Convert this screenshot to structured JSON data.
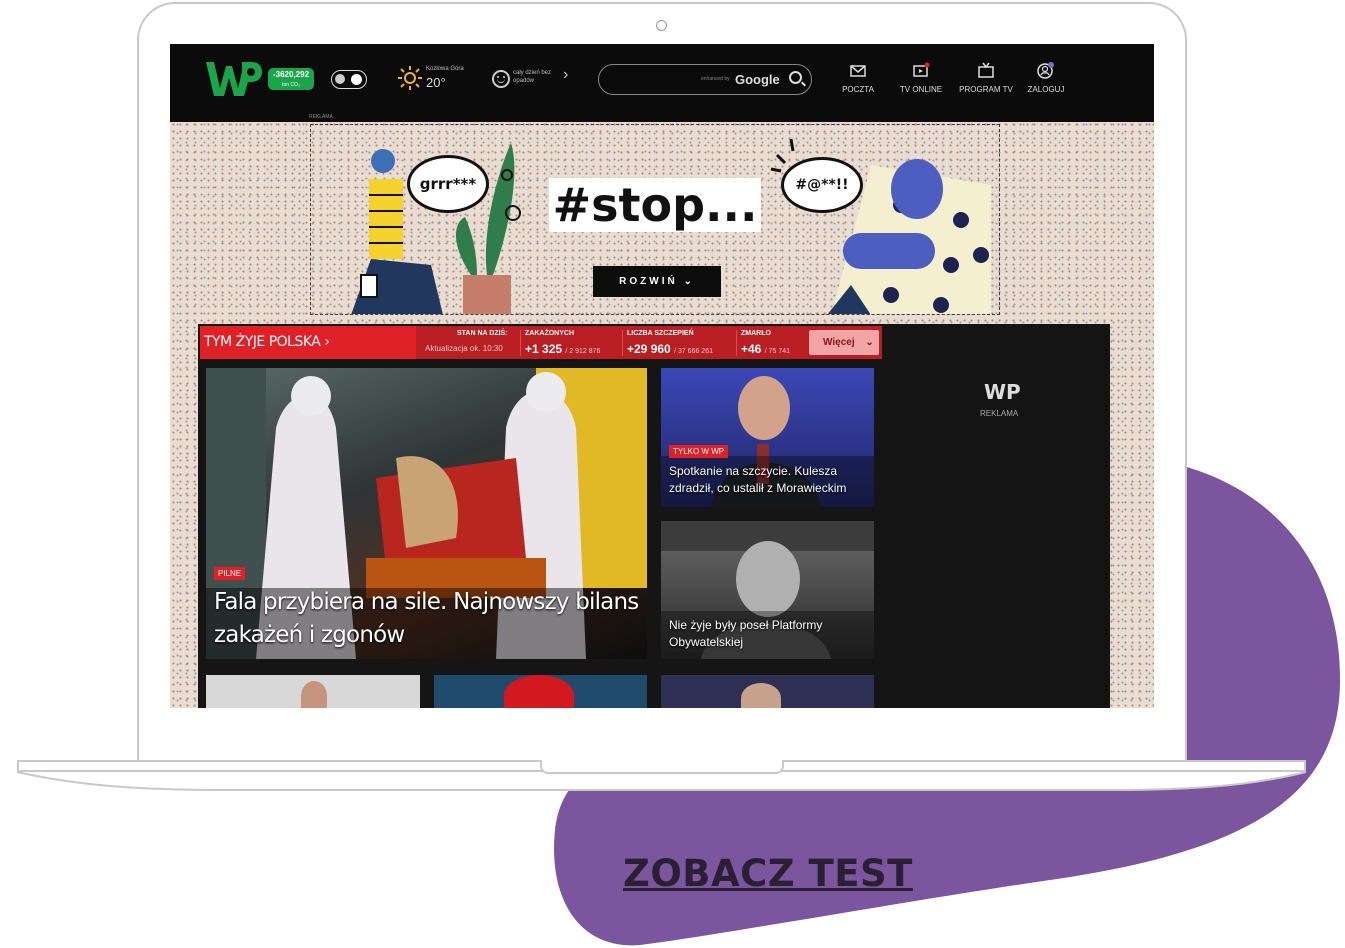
{
  "cta": {
    "label": "ZOBACZ TEST"
  },
  "topbar": {
    "co2_value": "-3620,292",
    "co2_unit": "ton CO₂",
    "weather_location": "Kozłowa Góra",
    "weather_temp": "20°",
    "forecast": "cały dzień bez opadów",
    "search_powered": "enhanced by",
    "search_brand": "Google",
    "nav": [
      "POCZTA",
      "TV ONLINE",
      "PROGRAM TV",
      "ZALOGUJ"
    ],
    "ad_label": "REKLAMA"
  },
  "ad_banner": {
    "headline": "#stop...",
    "bubble_left": "grrr***",
    "bubble_right": "#@**!!",
    "button": "ROZWIŃ"
  },
  "covid": {
    "title": "TYM ŻYJE POLSKA",
    "status_h": "STAN NA DZIŚ:",
    "status_sub": "Aktualizacja ok. 10:30",
    "infected_h": "ZAKAŻONYCH",
    "infected_v": "+1 325",
    "infected_total": "/ 2 912 876",
    "vacc_h": "LICZBA SZCZEPIEŃ",
    "vacc_v": "+29 960",
    "vacc_total": "/ 37 666 261",
    "deaths_h": "ZMARŁO",
    "deaths_v": "+46",
    "deaths_total": "/ 75 741",
    "more": "Więcej"
  },
  "side_ad": {
    "logo": "WP",
    "label": "REKLAMA"
  },
  "tiles": {
    "main_badge": "PILNE",
    "main_headline": "Fala przybiera na sile. Najnowszy bilans zakażeń i zgonów",
    "t1_badge": "TYLKO W WP",
    "t1_headline": "Spotkanie na szczycie. Kulesza zdradził, co ustalił z Morawieckim",
    "t2_headline": "Nie żyje były poseł Platformy Obywatelskiej"
  }
}
